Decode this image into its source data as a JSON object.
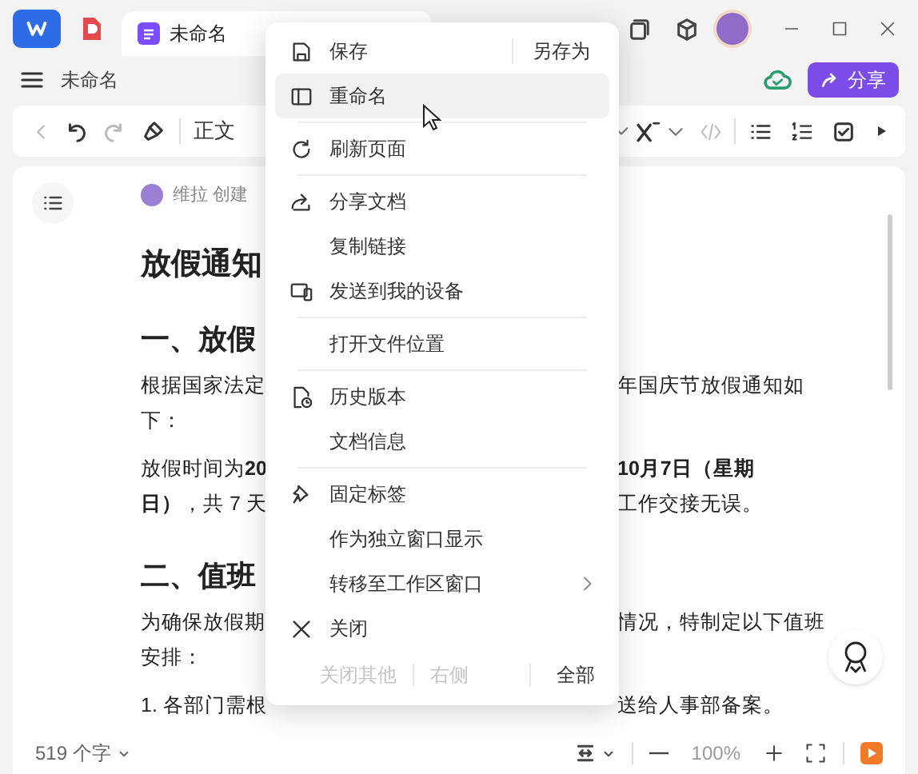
{
  "tabs": [
    {
      "label": "未命名",
      "selected": true
    }
  ],
  "doc_bar": {
    "title": "未命名",
    "share_button": "分享"
  },
  "toolbar": {
    "style": "正文"
  },
  "document": {
    "byline": "维拉 创建",
    "title": "放假通知",
    "blocks": [
      {
        "kind": "h2",
        "left": "一、放假"
      },
      {
        "kind": "p",
        "lines": [
          {
            "left": "根据国家法定",
            "right": "年国庆节放假通知如"
          },
          {
            "left": "下："
          }
        ]
      },
      {
        "kind": "p",
        "lines": [
          {
            "left": "放假时间为**20**",
            "right": "**10月7日（星期**"
          },
          {
            "left": "**日）**，共 7 天",
            "right": "工作交接无误。"
          }
        ]
      },
      {
        "kind": "h2",
        "left": "二、值班"
      },
      {
        "kind": "p",
        "lines": [
          {
            "left": "为确保放假期",
            "right": "情况，特制定以下值班"
          },
          {
            "left": "安排："
          }
        ]
      },
      {
        "kind": "p",
        "lines": [
          {
            "left": "1.  各部门需根",
            "right": "送给人事部备案。"
          }
        ]
      }
    ]
  },
  "menu": {
    "groups": [
      [
        {
          "label": "保存",
          "aside": "另存为",
          "highlighted": false
        },
        {
          "label": "重命名",
          "highlighted": true
        }
      ],
      [
        {
          "label": "刷新页面",
          "highlighted": false
        }
      ],
      [
        {
          "label": "分享文档",
          "highlighted": false
        },
        {
          "label": "复制链接",
          "highlighted": false
        },
        {
          "label": "发送到我的设备",
          "highlighted": false
        }
      ],
      [
        {
          "label": "打开文件位置",
          "highlighted": false
        }
      ],
      [
        {
          "label": "历史版本",
          "highlighted": false
        },
        {
          "label": "文档信息",
          "highlighted": false
        }
      ],
      [
        {
          "label": "固定标签",
          "highlighted": false
        },
        {
          "label": "作为独立窗口显示",
          "highlighted": false
        },
        {
          "label": "转移至工作区窗口",
          "submenu": true,
          "highlighted": false
        },
        {
          "label": "关闭",
          "highlighted": false
        }
      ]
    ],
    "close_row": [
      {
        "label": "关闭其他",
        "disabled": true
      },
      {
        "label": "右侧",
        "disabled": true
      },
      {
        "label": "全部",
        "disabled": false
      }
    ]
  },
  "status_bar": {
    "word_count": "519 个字",
    "zoom": "100%"
  }
}
